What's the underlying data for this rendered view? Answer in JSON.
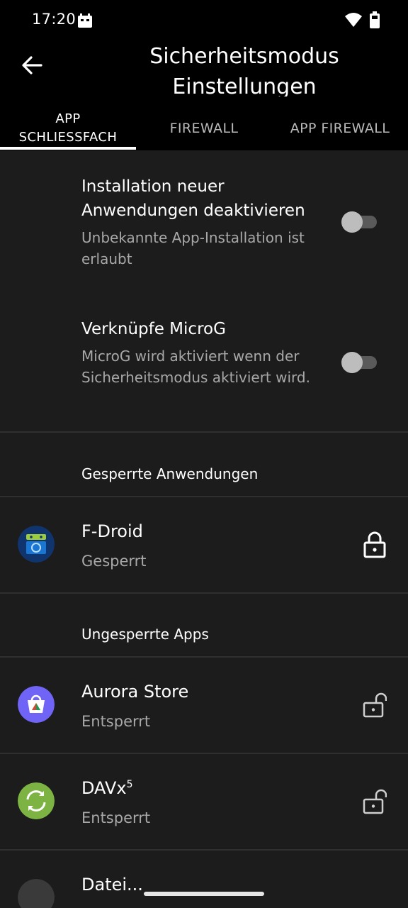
{
  "status_bar": {
    "time": "17:20"
  },
  "app_bar": {
    "title_line1": "Sicherheitsmodus",
    "title_line2": "Einstellungen"
  },
  "tabs": [
    {
      "line1": "APP",
      "line2": "SCHLIESSFACH"
    },
    {
      "label": "FIREWALL"
    },
    {
      "label": "APP FIREWALL"
    }
  ],
  "preferences": [
    {
      "title": "Installation neuer Anwendungen deaktivieren",
      "summary": "Unbekannte App-Installation ist erlaubt",
      "enabled": false
    },
    {
      "title": "Verknüpfe MicroG",
      "summary": "MicroG wird aktiviert wenn der Sicherheitsmodus aktiviert wird.",
      "enabled": false
    }
  ],
  "locked_section": {
    "header": "Gesperrte Anwendungen",
    "apps": [
      {
        "name": "F-Droid",
        "status": "Gesperrt",
        "icon": "fdroid-icon"
      }
    ]
  },
  "unlocked_section": {
    "header": "Ungesperrte Apps",
    "apps": [
      {
        "name": "Aurora Store",
        "status": "Entsperrt",
        "icon": "aurora-store-icon"
      },
      {
        "name": "DAVx",
        "name_sup": "5",
        "status": "Entsperrt",
        "icon": "davx5-icon"
      },
      {
        "name": "Datei...",
        "icon": "files-icon"
      }
    ]
  },
  "colors": {
    "background": "#1c1c1c",
    "bar": "#000000",
    "divider": "#2f2f2f",
    "secondary_text": "#a8a8a8"
  }
}
